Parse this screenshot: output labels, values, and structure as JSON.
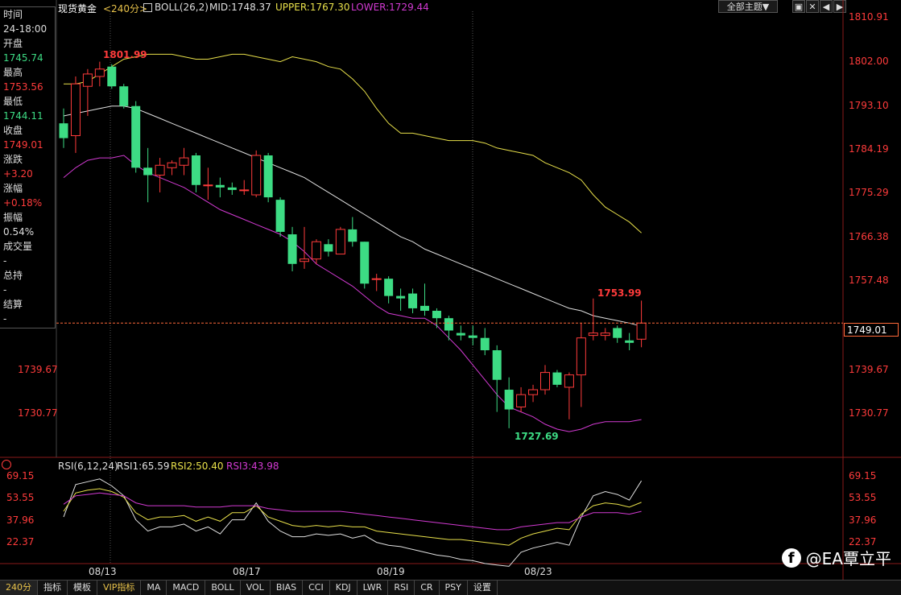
{
  "header": {
    "symbol": "现货黄金",
    "period": "<240分>",
    "indicator": "BOLL(26,2)",
    "mid": "MID:1748.37",
    "upper": "UPPER:1767.30",
    "lower": "LOWER:1729.44",
    "theme_btn": "全部主题▼"
  },
  "window_controls": [
    "▣",
    "✕",
    "◀",
    "▶"
  ],
  "info": {
    "time_label": "时间",
    "time_value": "24-18:00",
    "open_label": "开盘",
    "open_value": "1745.74",
    "high_label": "最高",
    "high_value": "1753.56",
    "low_label": "最低",
    "low_value": "1744.11",
    "close_label": "收盘",
    "close_value": "1749.01",
    "change_label": "涨跌",
    "change_value": "+3.20",
    "pct_label": "涨幅",
    "pct_value": "+0.18%",
    "amp_label": "振幅",
    "amp_value": "0.54%",
    "vol_label": "成交量",
    "vol_value": "-",
    "oi_label": "总持",
    "oi_value": "-",
    "settle_label": "结算",
    "settle_value": "-"
  },
  "price_axis": [
    "1810.91",
    "1802.00",
    "1793.10",
    "1784.19",
    "1775.29",
    "1766.38",
    "1757.48",
    "1739.67",
    "1730.77"
  ],
  "current_price": "1749.01",
  "left_axis": [
    "1739.67",
    "1730.77"
  ],
  "annotations": {
    "high": "1801.99",
    "low": "1727.69",
    "recent_high": "1753.99"
  },
  "rsi": {
    "title": "RSI(6,12,24)",
    "rsi1": "RSI1:65.59",
    "rsi2": "RSI2:50.40",
    "rsi3": "RSI3:43.98",
    "axis": [
      "69.15",
      "53.55",
      "37.96",
      "22.37"
    ]
  },
  "dates": [
    "08/13",
    "08/17",
    "08/19",
    "08/23"
  ],
  "tabs": [
    "240分",
    "指标",
    "模板",
    "VIP指标",
    "MA",
    "MACD",
    "BOLL",
    "VOL",
    "BIAS",
    "CCI",
    "KDJ",
    "LWR",
    "RSI",
    "CR",
    "PSY",
    "设置"
  ],
  "watermark": "@EA覃立平",
  "colors": {
    "up": "#ff3b3b",
    "down": "#3ddc84",
    "upper": "#e8e04a",
    "mid": "#e0e0e0",
    "lower": "#d23ad2"
  },
  "chart_data": {
    "type": "candlestick",
    "ylim": [
      1726,
      1812
    ],
    "candles": [
      {
        "o": 1789.5,
        "h": 1792.5,
        "l": 1784.5,
        "c": 1786.5
      },
      {
        "o": 1787.0,
        "h": 1799.0,
        "l": 1783.5,
        "c": 1797.5
      },
      {
        "o": 1797.0,
        "h": 1800.5,
        "l": 1791.0,
        "c": 1799.5
      },
      {
        "o": 1799.0,
        "h": 1801.99,
        "l": 1797.0,
        "c": 1800.5
      },
      {
        "o": 1801.0,
        "h": 1801.5,
        "l": 1796.5,
        "c": 1797.0
      },
      {
        "o": 1797.0,
        "h": 1797.5,
        "l": 1792.5,
        "c": 1793.0
      },
      {
        "o": 1793.0,
        "h": 1794.0,
        "l": 1779.5,
        "c": 1780.5
      },
      {
        "o": 1780.5,
        "h": 1784.5,
        "l": 1773.5,
        "c": 1779.0
      },
      {
        "o": 1779.0,
        "h": 1782.5,
        "l": 1775.5,
        "c": 1781.0
      },
      {
        "o": 1780.5,
        "h": 1782.0,
        "l": 1779.0,
        "c": 1781.5
      },
      {
        "o": 1781.0,
        "h": 1784.5,
        "l": 1779.0,
        "c": 1782.5
      },
      {
        "o": 1783.0,
        "h": 1783.5,
        "l": 1775.5,
        "c": 1777.0
      },
      {
        "o": 1777.0,
        "h": 1780.5,
        "l": 1774.0,
        "c": 1777.0
      },
      {
        "o": 1777.0,
        "h": 1778.5,
        "l": 1774.5,
        "c": 1776.5
      },
      {
        "o": 1776.5,
        "h": 1777.5,
        "l": 1775.0,
        "c": 1776.0
      },
      {
        "o": 1776.0,
        "h": 1778.0,
        "l": 1775.0,
        "c": 1776.0
      },
      {
        "o": 1775.0,
        "h": 1784.0,
        "l": 1774.5,
        "c": 1783.0
      },
      {
        "o": 1783.0,
        "h": 1783.5,
        "l": 1773.5,
        "c": 1774.5
      },
      {
        "o": 1774.0,
        "h": 1774.5,
        "l": 1766.5,
        "c": 1767.5
      },
      {
        "o": 1767.0,
        "h": 1768.5,
        "l": 1759.5,
        "c": 1761.0
      },
      {
        "o": 1761.5,
        "h": 1768.5,
        "l": 1760.0,
        "c": 1762.0
      },
      {
        "o": 1762.0,
        "h": 1766.0,
        "l": 1761.0,
        "c": 1765.5
      },
      {
        "o": 1765.0,
        "h": 1766.0,
        "l": 1762.5,
        "c": 1763.5
      },
      {
        "o": 1763.0,
        "h": 1768.5,
        "l": 1763.0,
        "c": 1768.0
      },
      {
        "o": 1768.0,
        "h": 1770.5,
        "l": 1764.5,
        "c": 1765.5
      },
      {
        "o": 1765.5,
        "h": 1765.5,
        "l": 1756.0,
        "c": 1757.0
      },
      {
        "o": 1758.0,
        "h": 1759.0,
        "l": 1755.5,
        "c": 1758.0
      },
      {
        "o": 1758.0,
        "h": 1758.5,
        "l": 1753.0,
        "c": 1754.5
      },
      {
        "o": 1754.5,
        "h": 1756.0,
        "l": 1751.5,
        "c": 1754.0
      },
      {
        "o": 1755.0,
        "h": 1756.0,
        "l": 1751.0,
        "c": 1752.0
      },
      {
        "o": 1752.5,
        "h": 1757.0,
        "l": 1750.5,
        "c": 1751.5
      },
      {
        "o": 1751.5,
        "h": 1752.0,
        "l": 1748.0,
        "c": 1750.0
      },
      {
        "o": 1750.0,
        "h": 1750.5,
        "l": 1745.5,
        "c": 1747.5
      },
      {
        "o": 1747.0,
        "h": 1748.5,
        "l": 1745.5,
        "c": 1746.5
      },
      {
        "o": 1746.5,
        "h": 1748.5,
        "l": 1744.5,
        "c": 1746.0
      },
      {
        "o": 1746.0,
        "h": 1748.0,
        "l": 1742.5,
        "c": 1743.5
      },
      {
        "o": 1743.5,
        "h": 1744.5,
        "l": 1731.0,
        "c": 1737.5
      },
      {
        "o": 1735.5,
        "h": 1738.0,
        "l": 1727.69,
        "c": 1731.5
      },
      {
        "o": 1732.0,
        "h": 1736.0,
        "l": 1731.0,
        "c": 1734.5
      },
      {
        "o": 1734.5,
        "h": 1736.5,
        "l": 1733.0,
        "c": 1735.5
      },
      {
        "o": 1735.5,
        "h": 1740.5,
        "l": 1734.5,
        "c": 1739.0
      },
      {
        "o": 1739.0,
        "h": 1739.5,
        "l": 1736.0,
        "c": 1736.5
      },
      {
        "o": 1736.0,
        "h": 1739.0,
        "l": 1729.5,
        "c": 1738.5
      },
      {
        "o": 1738.5,
        "h": 1749.0,
        "l": 1732.0,
        "c": 1746.0
      },
      {
        "o": 1746.5,
        "h": 1753.99,
        "l": 1745.5,
        "c": 1747.0
      },
      {
        "o": 1746.5,
        "h": 1748.0,
        "l": 1745.5,
        "c": 1747.0
      },
      {
        "o": 1748.0,
        "h": 1748.5,
        "l": 1745.0,
        "c": 1746.0
      },
      {
        "o": 1745.5,
        "h": 1747.0,
        "l": 1743.5,
        "c": 1745.0
      },
      {
        "o": 1745.74,
        "h": 1753.56,
        "l": 1744.11,
        "c": 1749.01
      }
    ],
    "upper": [
      1797.5,
      1797.5,
      1798.0,
      1799.5,
      1801.0,
      1802.5,
      1803.0,
      1803.5,
      1803.5,
      1803.5,
      1803.0,
      1802.5,
      1802.5,
      1803.0,
      1803.5,
      1803.5,
      1803.0,
      1802.5,
      1802.0,
      1803.0,
      1802.5,
      1802.0,
      1801.0,
      1800.5,
      1798.5,
      1796.0,
      1792.5,
      1789.5,
      1787.5,
      1787.5,
      1787.0,
      1786.5,
      1786.0,
      1786.0,
      1786.0,
      1785.5,
      1784.5,
      1784.0,
      1783.5,
      1783.0,
      1781.5,
      1780.5,
      1779.5,
      1778.0,
      1775.0,
      1772.5,
      1771.0,
      1769.5,
      1767.3
    ],
    "mid": [
      1791.0,
      1791.5,
      1792.0,
      1792.5,
      1793.0,
      1793.0,
      1792.5,
      1791.5,
      1790.5,
      1789.5,
      1788.5,
      1787.5,
      1786.5,
      1785.5,
      1784.5,
      1783.5,
      1782.5,
      1781.5,
      1780.5,
      1779.5,
      1778.5,
      1777.0,
      1775.5,
      1774.0,
      1772.5,
      1771.0,
      1769.5,
      1768.0,
      1766.5,
      1765.5,
      1764.0,
      1763.0,
      1762.0,
      1761.0,
      1760.0,
      1759.0,
      1758.0,
      1757.0,
      1756.0,
      1755.0,
      1754.0,
      1753.0,
      1752.0,
      1751.5,
      1750.5,
      1750.0,
      1749.5,
      1749.0,
      1748.37
    ],
    "lower": [
      1778.5,
      1780.5,
      1782.0,
      1782.5,
      1782.5,
      1783.0,
      1781.0,
      1779.5,
      1778.5,
      1777.5,
      1776.5,
      1775.0,
      1773.5,
      1772.0,
      1771.0,
      1770.0,
      1769.0,
      1768.0,
      1767.0,
      1765.5,
      1763.5,
      1761.0,
      1759.5,
      1758.0,
      1756.5,
      1754.5,
      1752.5,
      1751.0,
      1750.5,
      1750.0,
      1750.0,
      1748.5,
      1746.0,
      1743.5,
      1740.5,
      1737.5,
      1734.5,
      1732.0,
      1731.0,
      1730.0,
      1728.5,
      1727.5,
      1727.0,
      1727.5,
      1728.5,
      1729.0,
      1729.0,
      1729.0,
      1729.44
    ],
    "rsi1": [
      40,
      63,
      65,
      67,
      62,
      55,
      38,
      30,
      33,
      33,
      35,
      30,
      33,
      28,
      38,
      38,
      50,
      37,
      30,
      26,
      26,
      28,
      27,
      28,
      25,
      27,
      22,
      20,
      19,
      17,
      15,
      13,
      12,
      10,
      9,
      7,
      6,
      5,
      15,
      18,
      20,
      22,
      20,
      40,
      55,
      58,
      56,
      52,
      65.59
    ],
    "rsi2": [
      44,
      57,
      59,
      60,
      58,
      54,
      43,
      38,
      40,
      40,
      41,
      37,
      40,
      37,
      43,
      43,
      48,
      40,
      37,
      34,
      33,
      34,
      33,
      34,
      33,
      33,
      30,
      29,
      28,
      27,
      26,
      25,
      24,
      24,
      23,
      22,
      21,
      20,
      25,
      28,
      30,
      32,
      31,
      42,
      48,
      50,
      49,
      47,
      50.4
    ],
    "rsi3": [
      49,
      55,
      56,
      57,
      56,
      55,
      50,
      48,
      48,
      48,
      48,
      47,
      47,
      47,
      48,
      48,
      48,
      46,
      45,
      44,
      44,
      44,
      44,
      44,
      43,
      42,
      41,
      40,
      39,
      38,
      37,
      36,
      35,
      34,
      33,
      32,
      31,
      31,
      33,
      34,
      35,
      36,
      36,
      40,
      43,
      43,
      43,
      42,
      43.98
    ],
    "rsi_ylim": [
      15,
      75
    ],
    "date_ticks": [
      "08/13",
      "08/17",
      "08/19",
      "08/23"
    ]
  }
}
